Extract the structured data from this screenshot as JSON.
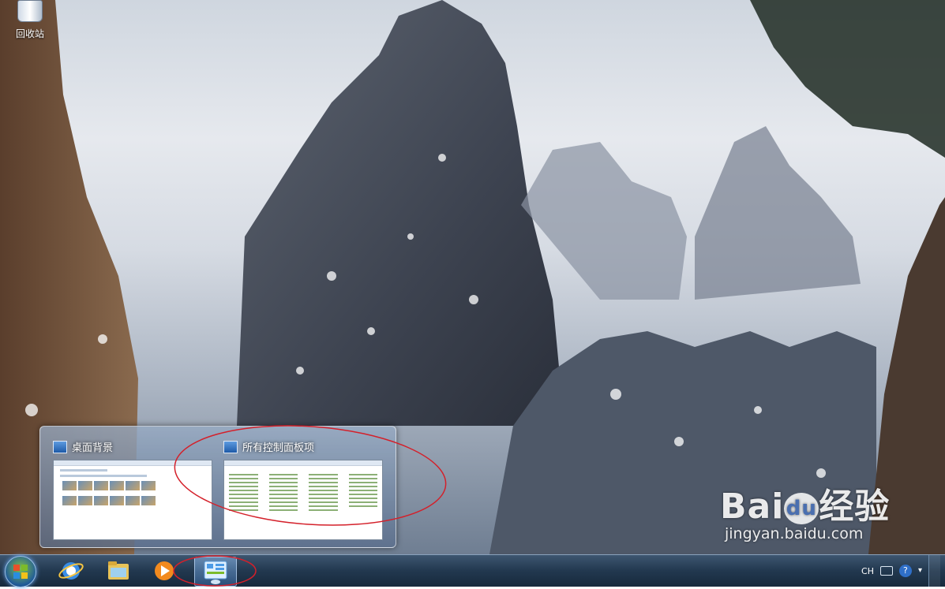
{
  "desktop": {
    "recycle_bin_label": "回收站"
  },
  "watermark": {
    "brand": "Bai",
    "brand_du": "du",
    "brand_suffix": "经验",
    "url": "jingyan.baidu.com"
  },
  "taskbar_preview": {
    "items": [
      {
        "title": "桌面背景",
        "icon": "desktop-background-icon"
      },
      {
        "title": "所有控制面板项",
        "icon": "control-panel-icon"
      }
    ]
  },
  "taskbar": {
    "start_icon": "windows-start-icon",
    "pinned": [
      {
        "name": "internet-explorer",
        "icon": "ie-icon"
      },
      {
        "name": "windows-explorer",
        "icon": "folder-icon"
      },
      {
        "name": "media-player",
        "icon": "media-player-icon"
      },
      {
        "name": "control-panel",
        "icon": "control-panel-icon",
        "active": true
      }
    ],
    "tray": {
      "language": "CH",
      "keyboard_icon": "keyboard-icon",
      "help_label": "?",
      "options_label": "▾"
    }
  },
  "annotations": {
    "highlight_color": "#d4202a"
  }
}
